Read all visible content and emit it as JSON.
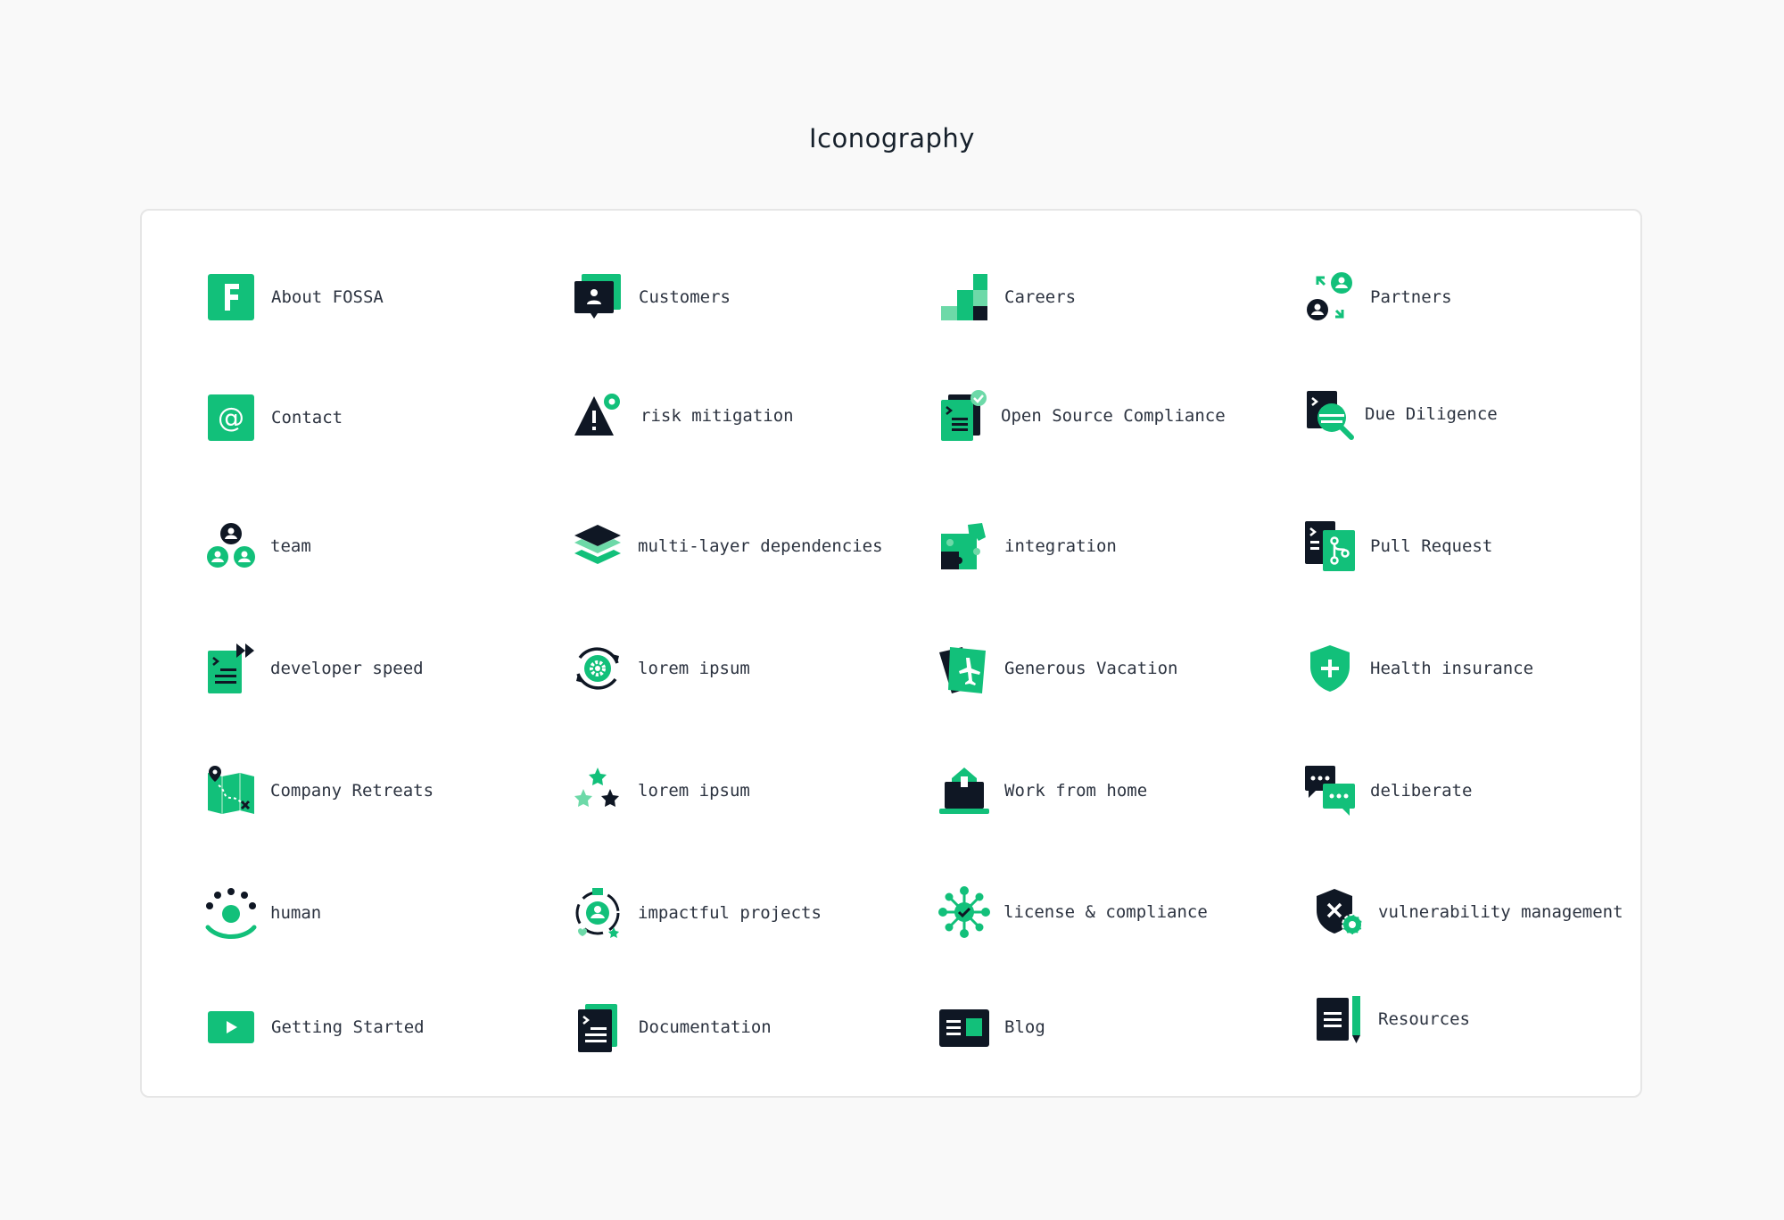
{
  "page": {
    "title": "Iconography"
  },
  "colors": {
    "green": "#12c07a",
    "green_light": "#6dd9a8",
    "navy": "#0f1724",
    "text": "#2c3340",
    "background": "#f9f9f9",
    "card": "#ffffff"
  },
  "icons": [
    {
      "label": "About FOSSA",
      "icon": "fossa-logo-icon"
    },
    {
      "label": "Customers",
      "icon": "customers-icon"
    },
    {
      "label": "Careers",
      "icon": "careers-stairs-icon"
    },
    {
      "label": "Partners",
      "icon": "partners-exchange-icon"
    },
    {
      "label": "Contact",
      "icon": "at-sign-icon"
    },
    {
      "label": "risk mitigation",
      "icon": "warning-gear-icon"
    },
    {
      "label": "Open Source Compliance",
      "icon": "compliance-document-icon"
    },
    {
      "label": "Due Diligence",
      "icon": "due-diligence-search-icon"
    },
    {
      "label": "team",
      "icon": "team-icon"
    },
    {
      "label": "multi-layer dependencies",
      "icon": "layers-icon"
    },
    {
      "label": "integration",
      "icon": "puzzle-icon"
    },
    {
      "label": "Pull Request",
      "icon": "pull-request-icon"
    },
    {
      "label": "developer speed",
      "icon": "fast-forward-document-icon"
    },
    {
      "label": "lorem ipsum",
      "icon": "sync-gear-icon"
    },
    {
      "label": "Generous Vacation",
      "icon": "plane-ticket-icon"
    },
    {
      "label": "Health insurance",
      "icon": "health-shield-icon"
    },
    {
      "label": "Company Retreats",
      "icon": "map-pin-icon"
    },
    {
      "label": "lorem ipsum",
      "icon": "stars-icon"
    },
    {
      "label": "Work from home",
      "icon": "house-laptop-icon"
    },
    {
      "label": "deliberate",
      "icon": "chat-bubbles-icon"
    },
    {
      "label": "human",
      "icon": "human-icon"
    },
    {
      "label": "impactful projects",
      "icon": "impact-projects-icon"
    },
    {
      "label": "license & compliance",
      "icon": "network-check-icon"
    },
    {
      "label": "vulnerability management",
      "icon": "shield-x-gear-icon"
    },
    {
      "label": "Getting Started",
      "icon": "play-button-icon"
    },
    {
      "label": "Documentation",
      "icon": "documentation-icon"
    },
    {
      "label": "Blog",
      "icon": "blog-icon"
    },
    {
      "label": "Resources",
      "icon": "resources-pencil-icon"
    }
  ]
}
